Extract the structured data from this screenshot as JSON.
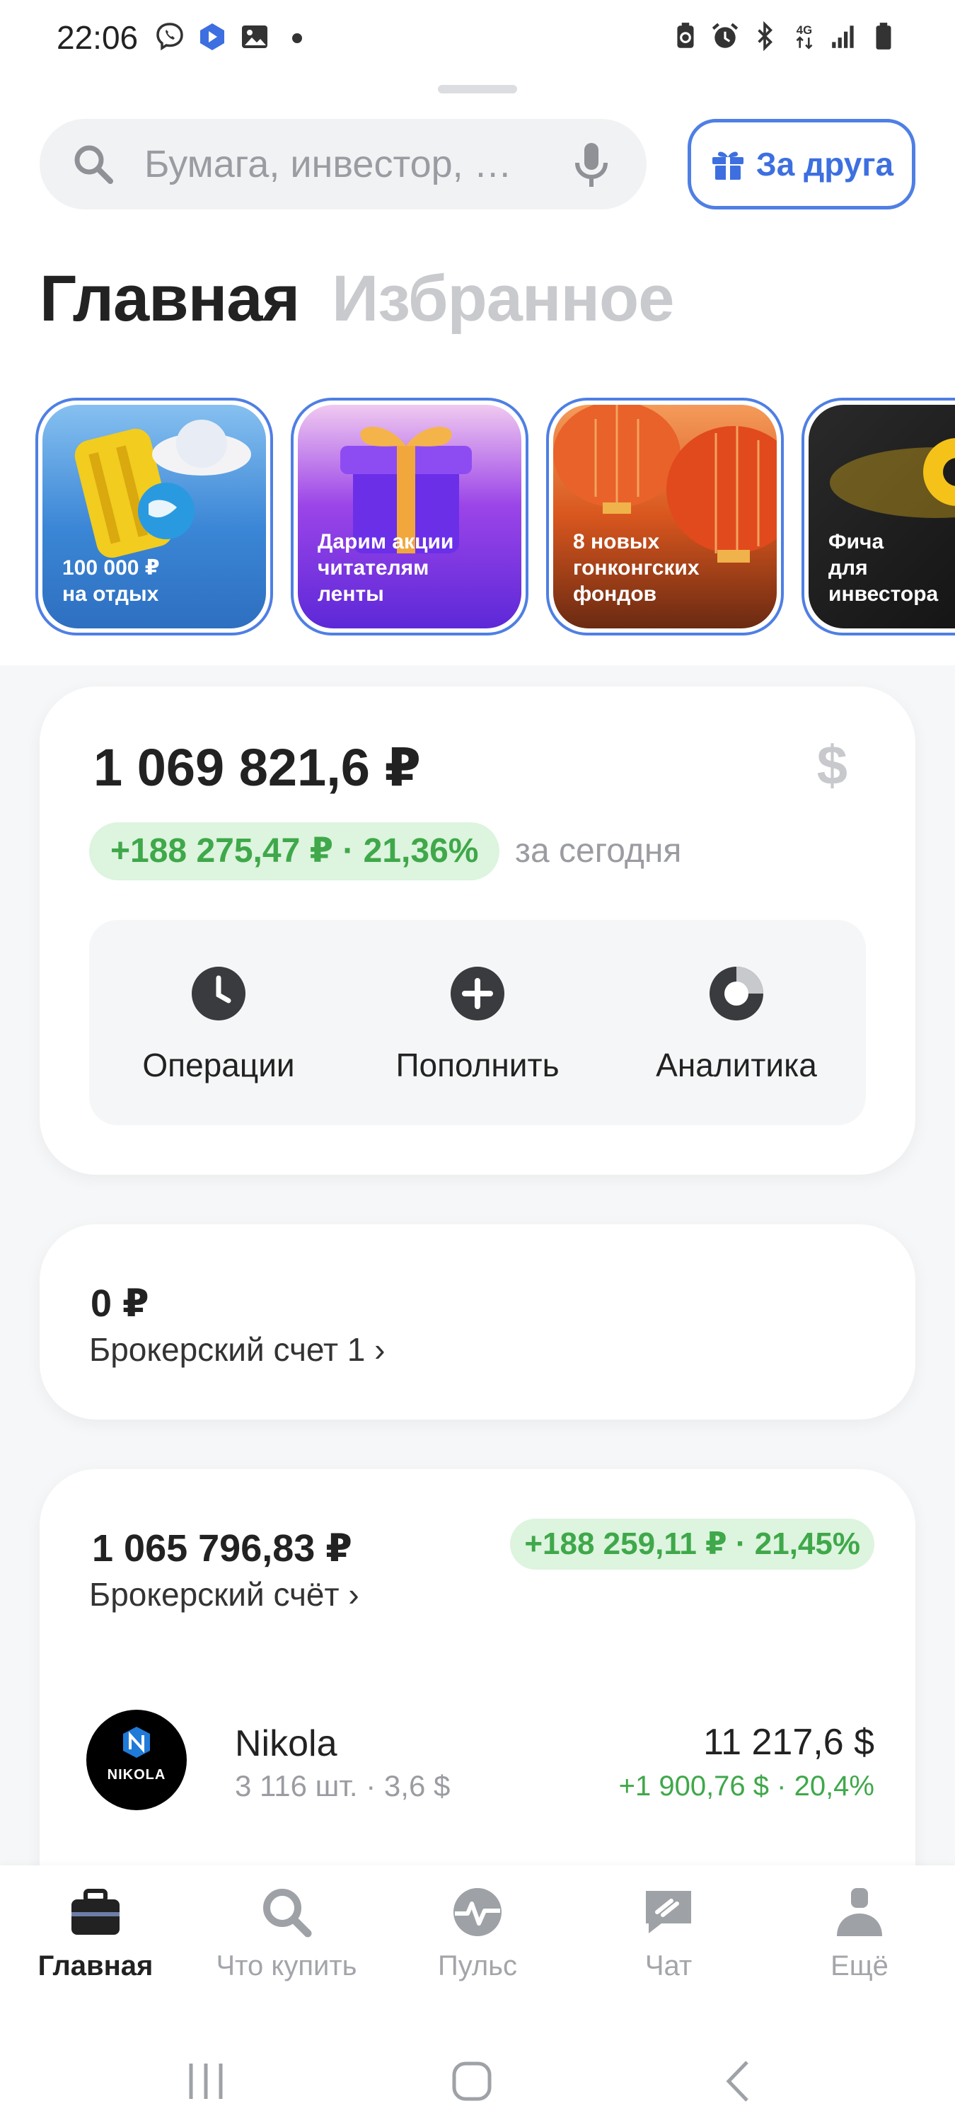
{
  "status_bar": {
    "time": "22:06",
    "icons_left": [
      "viber-icon",
      "app-icon",
      "gallery-icon",
      "dot"
    ],
    "icons_right": [
      "recycle-icon",
      "alarm-icon",
      "bluetooth-icon",
      "network-4g-icon",
      "signal-icon",
      "battery-icon"
    ],
    "network_label": "4G"
  },
  "search": {
    "placeholder": "Бумага, инвестор, …"
  },
  "invite_button": {
    "label": "За друга"
  },
  "tabs": [
    {
      "label": "Главная",
      "active": true
    },
    {
      "label": "Избранное",
      "active": false
    }
  ],
  "stories": [
    {
      "text": "100 000 ₽\nна отдых"
    },
    {
      "text": "Дарим акции\nчитателям\nленты"
    },
    {
      "text": "8 новых\nгонконгских\nфондов"
    },
    {
      "text": "Фича\nдля\nинвестора"
    }
  ],
  "portfolio": {
    "total_value": "1 069 821,6 ₽",
    "currency_icon": "$",
    "gain": "+188 275,47 ₽ · 21,36%",
    "gain_period": "за сегодня",
    "actions": [
      {
        "label": "Операции",
        "icon": "clock-icon"
      },
      {
        "label": "Пополнить",
        "icon": "plus-icon"
      },
      {
        "label": "Аналитика",
        "icon": "pie-icon"
      }
    ]
  },
  "broker_account_1": {
    "value": "0 ₽",
    "name": "Брокерский счет 1 ›"
  },
  "broker_account_2": {
    "value": "1 065 796,83 ₽",
    "name": "Брокерский счёт ›",
    "gain": "+188 259,11 ₽ · 21,45%",
    "assets": [
      {
        "name": "Nikola",
        "meta": "3 116 шт. · 3,6 $",
        "value": "11 217,6 $",
        "change": "+1 900,76 $ · 20,4%",
        "logo_text": "NIKOLA"
      }
    ]
  },
  "bottom_nav": [
    {
      "label": "Главная",
      "icon": "briefcase-icon",
      "active": true
    },
    {
      "label": "Что купить",
      "icon": "search-icon",
      "active": false
    },
    {
      "label": "Пульс",
      "icon": "pulse-icon",
      "active": false
    },
    {
      "label": "Чат",
      "icon": "chat-icon",
      "active": false
    },
    {
      "label": "Ещё",
      "icon": "profile-icon",
      "active": false
    }
  ],
  "colors": {
    "accent": "#4f7fe4",
    "positive": "#3fa84a",
    "positive_bg": "#ddf4de",
    "muted": "#9a9ca1"
  }
}
